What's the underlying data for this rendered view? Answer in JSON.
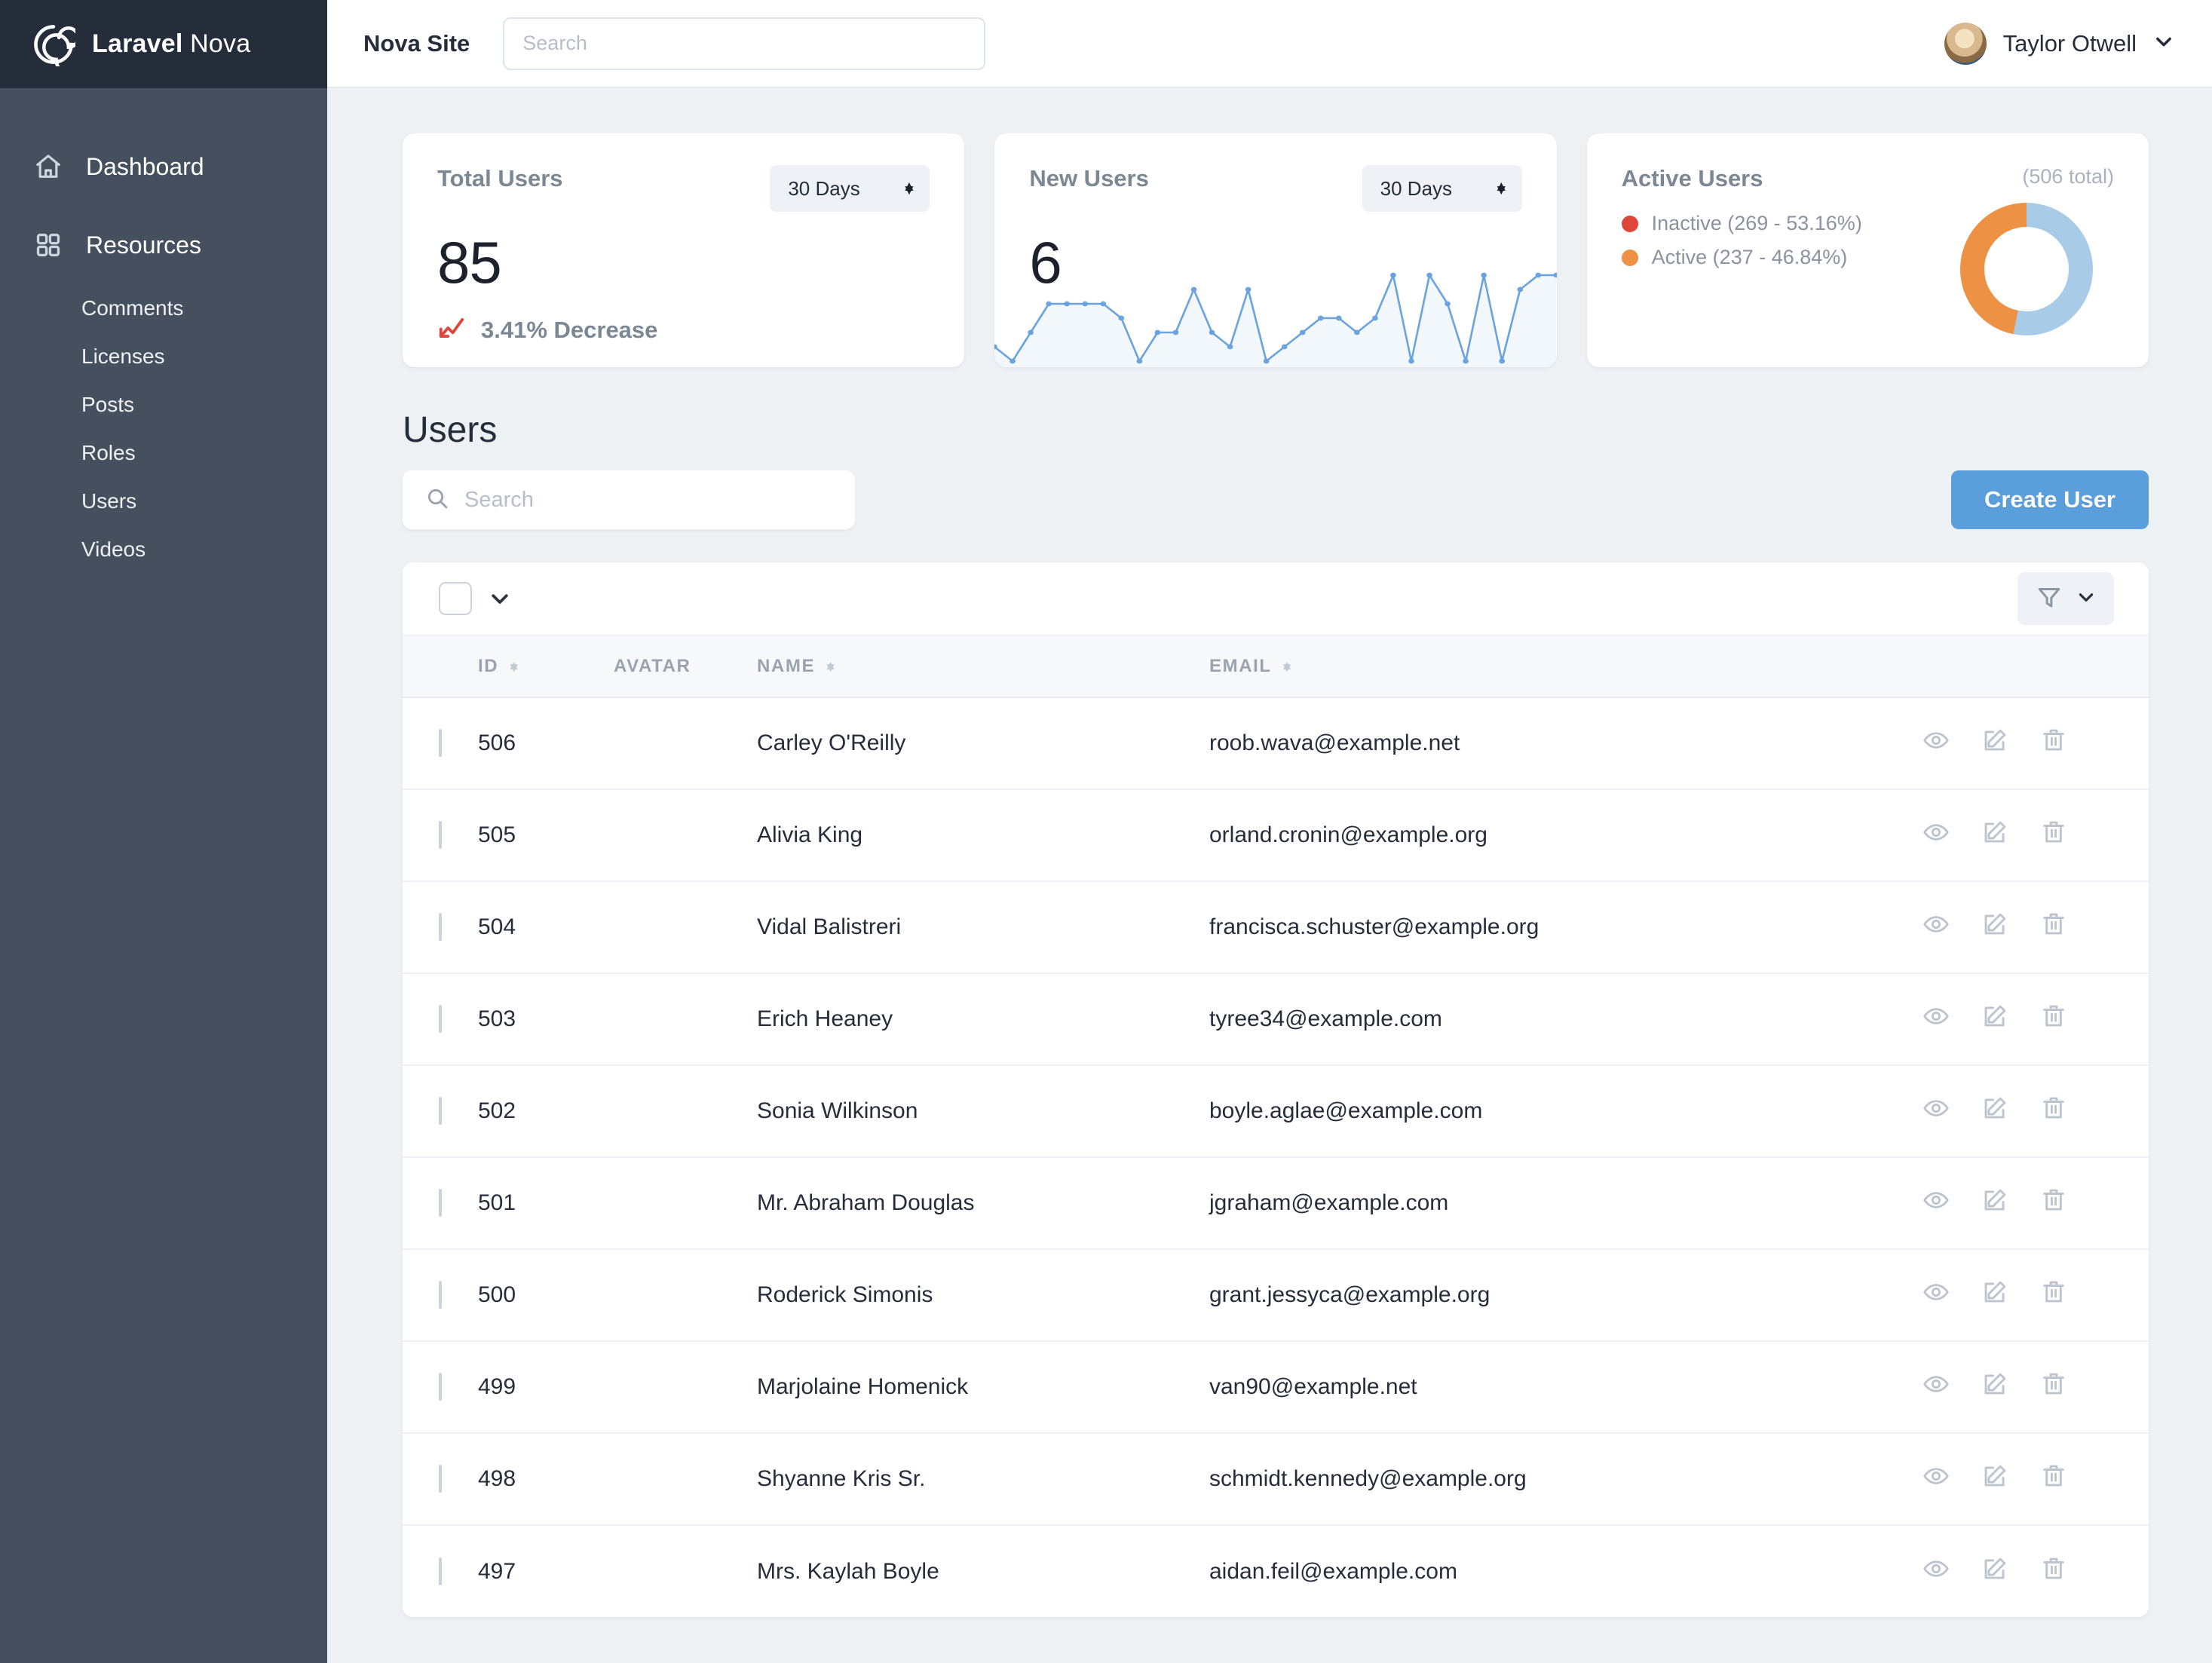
{
  "brand": {
    "name_bold": "Laravel",
    "name_light": "Nova",
    "logo_icon": "spiral-logo-icon"
  },
  "sidebar": {
    "main_items": [
      {
        "label": "Dashboard",
        "icon": "home-icon"
      },
      {
        "label": "Resources",
        "icon": "grid-squares-icon"
      }
    ],
    "sub_items": [
      {
        "label": "Comments"
      },
      {
        "label": "Licenses"
      },
      {
        "label": "Posts"
      },
      {
        "label": "Roles"
      },
      {
        "label": "Users"
      },
      {
        "label": "Videos"
      }
    ]
  },
  "topbar": {
    "site_title": "Nova Site",
    "search_placeholder": "Search",
    "search_value": "",
    "user_name": "Taylor Otwell",
    "chevron_icon": "chevron-down-icon",
    "avatar_icon": "user-avatar"
  },
  "metrics": {
    "total_users": {
      "title": "Total Users",
      "period": "30 Days",
      "value": "85",
      "trend_text": "3.41% Decrease",
      "trend_icon": "trend-down-icon",
      "trend_color": "#e0453a"
    },
    "new_users": {
      "title": "New Users",
      "period": "30 Days",
      "value": "6",
      "line_color": "#6aa3dd",
      "fill_color": "#f2f7fc"
    },
    "active_users": {
      "title": "Active Users",
      "total_label": "(506 total)",
      "legend": [
        {
          "label": "Inactive (269 - 53.16%)",
          "dot_color": "#e0453a"
        },
        {
          "label": "Active (237 - 46.84%)",
          "dot_color": "#ed9144"
        }
      ]
    }
  },
  "chart_data": [
    {
      "type": "line",
      "title": "New Users",
      "xlabel": "",
      "ylabel": "",
      "ylim": [
        0,
        6
      ],
      "grid": false,
      "legend": "none",
      "x": [
        1,
        2,
        3,
        4,
        5,
        6,
        7,
        8,
        9,
        10,
        11,
        12,
        13,
        14,
        15,
        16,
        17,
        18,
        19,
        20,
        21,
        22,
        23,
        24,
        25,
        26,
        27,
        28,
        29,
        30,
        31,
        32
      ],
      "values": [
        1,
        0,
        2,
        4,
        4,
        4,
        4,
        3,
        0,
        2,
        2,
        5,
        2,
        1,
        5,
        0,
        1,
        2,
        3,
        3,
        2,
        3,
        6,
        0,
        6,
        4,
        0,
        6,
        0,
        5,
        6,
        6
      ]
    },
    {
      "type": "pie",
      "title": "Active Users",
      "total": 506,
      "categories": [
        "Inactive",
        "Active"
      ],
      "values": [
        269,
        237
      ],
      "percentages": [
        53.16,
        46.84
      ],
      "colors": [
        "#a8cbe8",
        "#ed9144"
      ],
      "legend": "left",
      "donut": true
    }
  ],
  "resource": {
    "title": "Users",
    "search_placeholder": "Search",
    "search_value": "",
    "create_label": "Create User",
    "search_icon": "search-icon",
    "filter_icon": "filter-funnel-icon",
    "chevron_icon": "chevron-down-icon"
  },
  "table": {
    "columns": [
      {
        "label": "ID",
        "sortable": true
      },
      {
        "label": "AVATAR",
        "sortable": false
      },
      {
        "label": "NAME",
        "sortable": true
      },
      {
        "label": "EMAIL",
        "sortable": true
      }
    ],
    "actions": [
      {
        "name": "view",
        "icon": "eye-icon"
      },
      {
        "name": "edit",
        "icon": "pencil-square-icon"
      },
      {
        "name": "delete",
        "icon": "trash-icon"
      }
    ],
    "rows": [
      {
        "id": "506",
        "name": "Carley O'Reilly",
        "email": "roob.wava@example.net",
        "avatar_colors": [
          "#cbb4a8",
          "#6b4a44",
          "#2f2026"
        ]
      },
      {
        "id": "505",
        "name": "Alivia King",
        "email": "orland.cronin@example.org",
        "avatar_colors": [
          "#e8bb94",
          "#b5714a",
          "#3f4d68"
        ]
      },
      {
        "id": "504",
        "name": "Vidal Balistreri",
        "email": "francisca.schuster@example.org",
        "avatar_colors": [
          "#f0e2dc",
          "#c99d8e",
          "#4a3a3a"
        ]
      },
      {
        "id": "503",
        "name": "Erich Heaney",
        "email": "tyree34@example.com",
        "avatar_colors": [
          "#f3e6cf",
          "#d3b68c",
          "#8a7355"
        ]
      },
      {
        "id": "502",
        "name": "Sonia Wilkinson",
        "email": "boyle.aglae@example.com",
        "avatar_colors": [
          "#e2a98c",
          "#b96f51",
          "#5c3a2e"
        ]
      },
      {
        "id": "501",
        "name": "Mr. Abraham Douglas",
        "email": "jgraham@example.com",
        "avatar_colors": [
          "#cfd6dd",
          "#5e6b7a",
          "#232a33"
        ]
      },
      {
        "id": "500",
        "name": "Roderick Simonis",
        "email": "grant.jessyca@example.org",
        "avatar_colors": [
          "#e7cfc0",
          "#9e6f63",
          "#33242a"
        ]
      },
      {
        "id": "499",
        "name": "Marjolaine Homenick",
        "email": "van90@example.net",
        "avatar_colors": [
          "#e0bb9c",
          "#9b6a4a",
          "#4a3022"
        ]
      },
      {
        "id": "498",
        "name": "Shyanne Kris Sr.",
        "email": "schmidt.kennedy@example.org",
        "avatar_colors": [
          "#eab88e",
          "#c07a4c",
          "#5b3520"
        ]
      },
      {
        "id": "497",
        "name": "Mrs. Kaylah Boyle",
        "email": "aidan.feil@example.com",
        "avatar_colors": [
          "#d9c2ad",
          "#8d6450",
          "#2e2322"
        ]
      }
    ]
  }
}
